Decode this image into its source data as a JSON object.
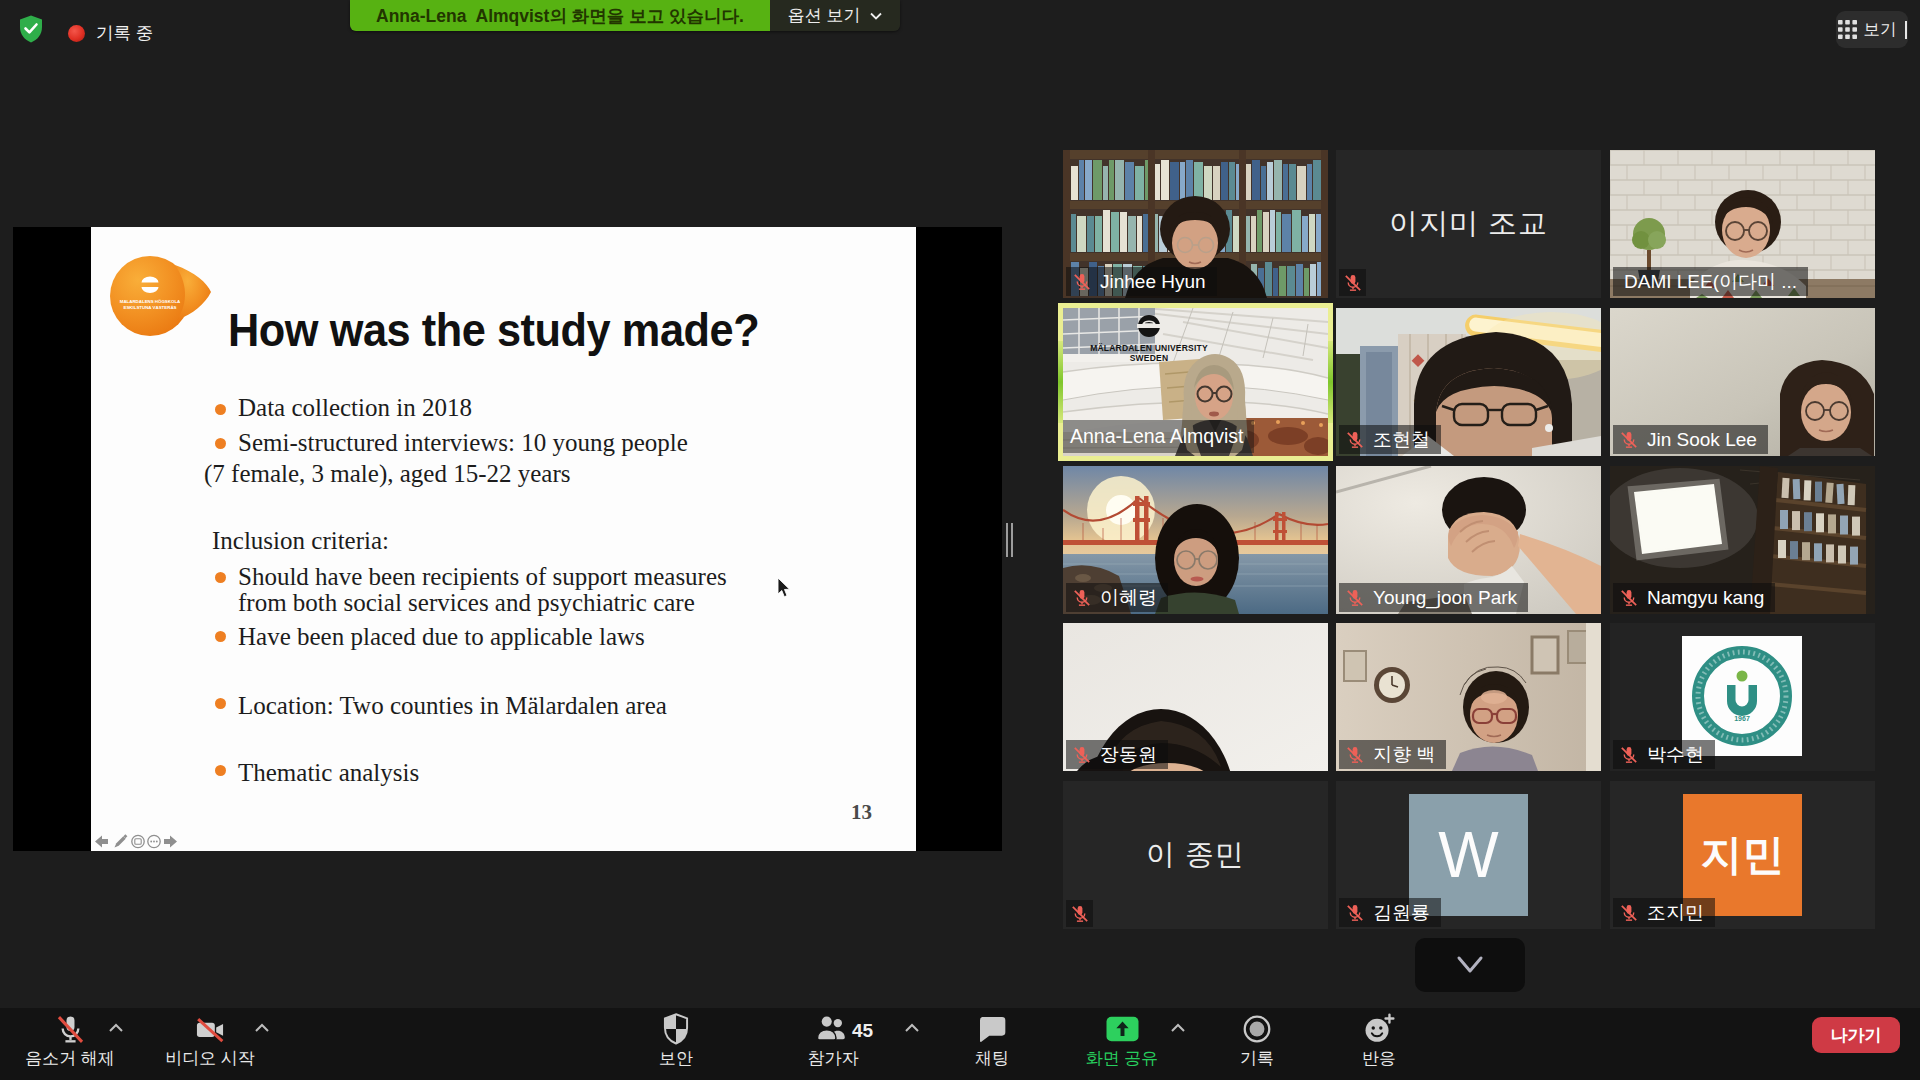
{
  "topbar": {
    "recording_label": "기록 중",
    "banner_text": "Anna-Lena  Almqvist의 화면을 보고 있습니다.",
    "options_label": "옵션 보기",
    "view_label": "보기"
  },
  "slide": {
    "logo_line1": "MÄLARDALENS HÖGSKOLA",
    "logo_line2": "ESKILSTUNA VÄSTERÅS",
    "title": "How was the study made?",
    "lines": [
      {
        "text": "Data collection in 2018",
        "bullet": true
      },
      {
        "text": "Semi-structured interviews: 10 young people",
        "bullet": true
      },
      {
        "text": "(7 female, 3 male), aged 15-22 years",
        "bullet": false
      },
      {
        "text": "Inclusion criteria:",
        "bullet": false
      },
      {
        "text": "Should have been recipients of support measures",
        "bullet": true
      },
      {
        "text": "from both social services and psychiatric care",
        "bullet": false
      },
      {
        "text": "Have been placed due to applicable laws",
        "bullet": true
      },
      {
        "text": "Location: Two counties in Mälardalen area",
        "bullet": true
      },
      {
        "text": "Thematic analysis",
        "bullet": true
      }
    ],
    "page_number": "13"
  },
  "sharing": {
    "presenter_university_line1": "MÄLARDALEN UNIVERSITY",
    "presenter_university_line2": "SWEDEN"
  },
  "participants": [
    {
      "name": "Jinhee Hyun",
      "muted": true
    },
    {
      "name": "이지미 조교",
      "muted": true,
      "display_text": "이지미 조교"
    },
    {
      "name": "DAMI LEE(이다미 ...",
      "muted": false
    },
    {
      "name": "Anna-Lena Almqvist",
      "muted": false,
      "active_speaker": true
    },
    {
      "name": "조현철",
      "muted": true
    },
    {
      "name": "Jin Sook Lee",
      "muted": true
    },
    {
      "name": "이혜령",
      "muted": true
    },
    {
      "name": "Young_joon Park",
      "muted": true
    },
    {
      "name": "Namgyu kang",
      "muted": true
    },
    {
      "name": "장동원",
      "muted": true
    },
    {
      "name": "지향 백",
      "muted": true
    },
    {
      "name": "박수현",
      "muted": true,
      "logo_year": "1967"
    },
    {
      "name": "이 종민",
      "muted": true,
      "display_text": "이 종민"
    },
    {
      "name": "김원룡",
      "muted": true,
      "avatar_letter": "W"
    },
    {
      "name": "조지민",
      "muted": true,
      "avatar_letter": "지민"
    }
  ],
  "toolbar": {
    "mute_label": "음소거 해제",
    "video_label": "비디오 시작",
    "security_label": "보안",
    "participants_label": "참가자",
    "participants_count": "45",
    "chat_label": "채팅",
    "share_label": "화면 공유",
    "record_label": "기록",
    "reactions_label": "반응",
    "leave_label": "나가기"
  },
  "colors": {
    "banner_green": "#57b212",
    "share_green": "#2dd05e",
    "leave_red": "#cf3a45",
    "muted_red": "#ee6158",
    "active_border": "#edf19e",
    "bullet_orange": "#ee7f22"
  }
}
